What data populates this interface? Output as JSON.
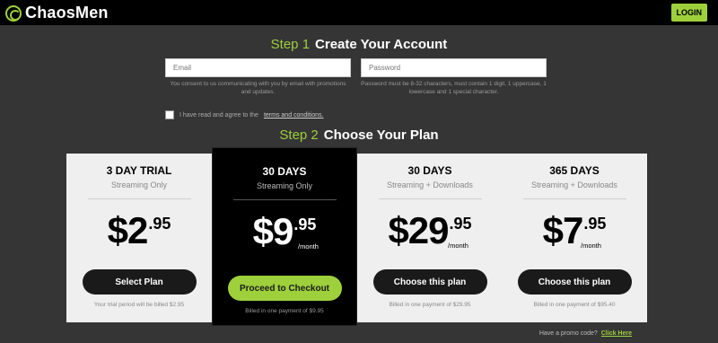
{
  "header": {
    "logo_text": "ChaosMen",
    "login_label": "LOGIN"
  },
  "step1": {
    "number": "Step 1",
    "title": "Create Your Account",
    "email_placeholder": "Email",
    "password_placeholder": "Password",
    "email_hint": "You consent to us communicating with you by email with promotions and updates.",
    "password_hint": "Password must be 8-32 characters, must contain 1 digit, 1 uppercase, 1 lowercase and 1 special character.",
    "terms_prefix": "I have read and agree to the",
    "terms_link": "terms and conditions."
  },
  "step2": {
    "number": "Step 2",
    "title": "Choose Your Plan"
  },
  "plans": [
    {
      "title": "3 DAY TRIAL",
      "subtitle": "Streaming Only",
      "currency": "$",
      "dollars": "2",
      "cents": ".95",
      "per": "",
      "button": "Select Plan",
      "note": "Your trial period will be billed $2.95"
    },
    {
      "title": "30 DAYS",
      "subtitle": "Streaming Only",
      "currency": "$",
      "dollars": "9",
      "cents": ".95",
      "per": "/month",
      "button": "Proceed to Checkout",
      "note": "Billed in one payment of $9.95"
    },
    {
      "title": "30 DAYS",
      "subtitle": "Streaming + Downloads",
      "currency": "$",
      "dollars": "29",
      "cents": ".95",
      "per": "/month",
      "button": "Choose this plan",
      "note": "Billed in one payment of $29.95"
    },
    {
      "title": "365 DAYS",
      "subtitle": "Streaming + Downloads",
      "currency": "$",
      "dollars": "7",
      "cents": ".95",
      "per": "/month",
      "button": "Choose this plan",
      "note": "Billed in one payment of $95.40"
    }
  ],
  "promo": {
    "text": "Have a promo code?",
    "link": "Click Here"
  },
  "colors": {
    "accent": "#9ed03c",
    "background": "#353535",
    "header": "#000000"
  }
}
